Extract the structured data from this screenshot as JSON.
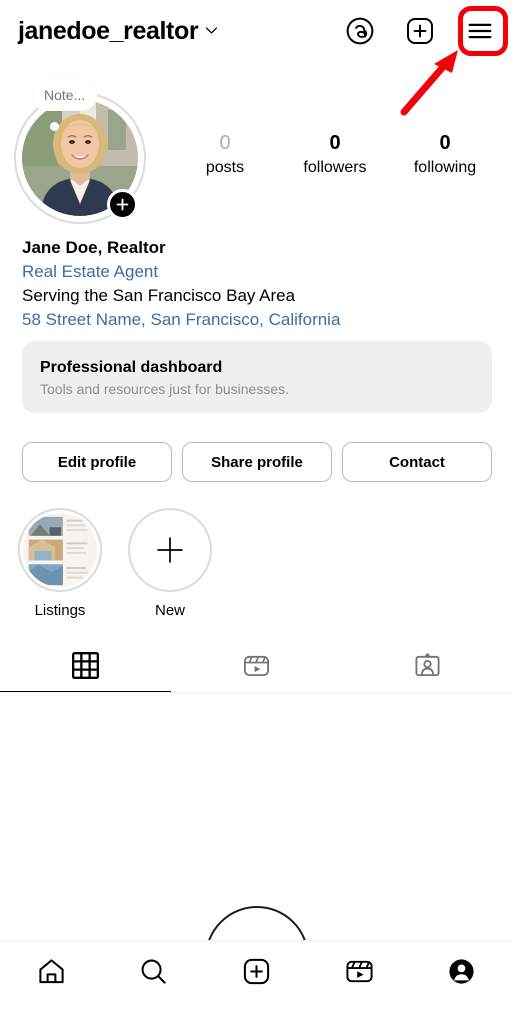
{
  "app": "Instagram",
  "header": {
    "username": "janedoe_realtor",
    "chevron_icon": "chevron-down-icon",
    "icons": [
      {
        "name": "threads-icon",
        "label": "Threads"
      },
      {
        "name": "new-post-icon",
        "label": "New post"
      },
      {
        "name": "hamburger-menu-icon",
        "label": "Menu"
      }
    ]
  },
  "annotation": {
    "highlight_color": "#f3010a",
    "target": "hamburger-menu-icon"
  },
  "profile": {
    "note_bubble": "Note...",
    "add_story_label": "+",
    "stats": [
      {
        "value": "0",
        "label": "posts",
        "muted": true
      },
      {
        "value": "0",
        "label": "followers",
        "muted": false
      },
      {
        "value": "0",
        "label": "following",
        "muted": false
      }
    ],
    "bio": {
      "name": "Jane Doe, Realtor",
      "category": "Real Estate Agent",
      "description": "Serving the San Francisco Bay Area",
      "address": "58 Street Name, San Francisco, California",
      "link_color": "#3a6ea5"
    }
  },
  "dashboard": {
    "title": "Professional dashboard",
    "subtitle": "Tools and resources just for businesses.",
    "background": "#efefef"
  },
  "actions": [
    {
      "label": "Edit profile",
      "name": "edit-profile-button"
    },
    {
      "label": "Share profile",
      "name": "share-profile-button"
    },
    {
      "label": "Contact",
      "name": "contact-button"
    }
  ],
  "highlights": [
    {
      "label": "Listings",
      "name": "highlight-listings",
      "type": "cover"
    },
    {
      "label": "New",
      "name": "highlight-new",
      "type": "add"
    }
  ],
  "tabs": [
    {
      "name": "tab-grid",
      "icon": "grid-icon",
      "active": true
    },
    {
      "name": "tab-reels",
      "icon": "reels-icon",
      "active": false
    },
    {
      "name": "tab-tagged",
      "icon": "tagged-icon",
      "active": false
    }
  ],
  "bottom_nav": [
    {
      "name": "nav-home",
      "icon": "home-icon"
    },
    {
      "name": "nav-search",
      "icon": "search-icon"
    },
    {
      "name": "nav-create",
      "icon": "plus-square-icon"
    },
    {
      "name": "nav-reels",
      "icon": "reels-icon"
    },
    {
      "name": "nav-profile",
      "icon": "profile-avatar-icon"
    }
  ]
}
